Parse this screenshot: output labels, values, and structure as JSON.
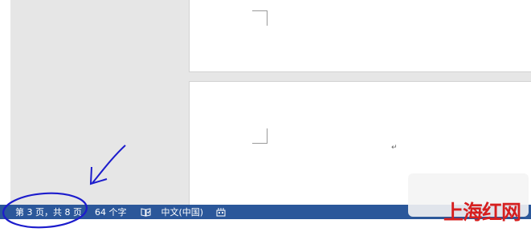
{
  "statusbar": {
    "page_info": "第 3 页，共 8 页",
    "word_count": "64 个字",
    "proofing_icon": "proofing-book-icon",
    "language": "中文(中国)",
    "layout_icon": "macro-record-icon"
  },
  "document": {
    "paragraph_mark": "↵"
  },
  "watermark": {
    "text": "上海红网"
  },
  "colors": {
    "statusbar_bg": "#2b579a",
    "statusbar_text": "#ffffff",
    "annotation_ink": "#1c1ccc",
    "watermark_red": "#d61f1f"
  }
}
